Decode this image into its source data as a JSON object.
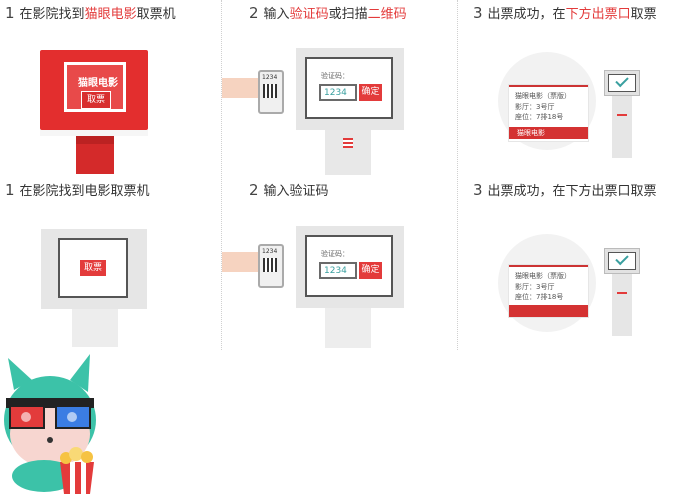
{
  "row1": {
    "step1": {
      "num": "1",
      "pre": "在影院找到",
      "highlight": "猫眼电影",
      "post": "取票机"
    },
    "step2": {
      "num": "2",
      "pre": "输入",
      "highlight1": "验证码",
      "mid": "或扫描",
      "highlight2": "二维码"
    },
    "step3": {
      "num": "3",
      "pre": "出票成功，在",
      "highlight": "下方出票口",
      "post": "取票"
    }
  },
  "row2": {
    "step1": {
      "num": "1",
      "text": "在影院找到电影取票机"
    },
    "step2": {
      "num": "2",
      "text": "输入验证码"
    },
    "step3": {
      "num": "3",
      "text": "出票成功，在下方出票口取票"
    }
  },
  "kiosk": {
    "logo": "猫眼电影",
    "ticket_button": "取票",
    "code_label": "验证码：",
    "code_value": "1234",
    "confirm_button": "确定",
    "phone_code": "1234"
  },
  "ticket": {
    "title": "猫眼电影（票版）",
    "hall_label": "影厅：",
    "hall_value": "3号厅",
    "seat_label": "座位：",
    "seat_value": "7排18号",
    "footer_logo": "猫眼电影"
  },
  "colors": {
    "accent": "#e33b3b",
    "code_text": "#3aa0a0",
    "mascot": "#3cc2a8"
  }
}
